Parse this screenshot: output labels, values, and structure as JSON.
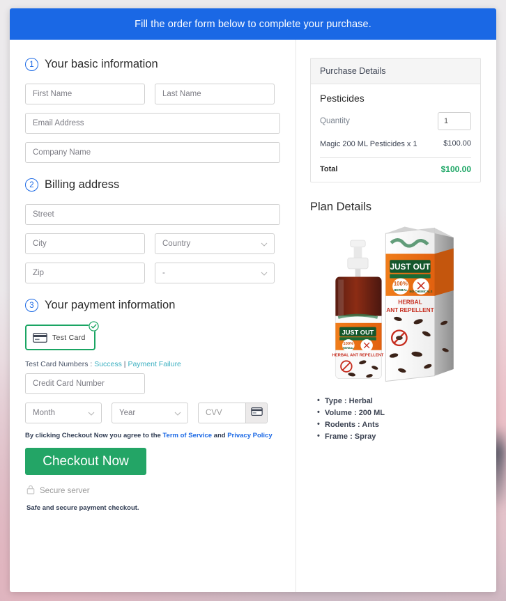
{
  "banner": {
    "text": "Fill the order form below to complete your purchase."
  },
  "steps": {
    "basic": {
      "num": "1",
      "title": "Your basic information"
    },
    "billing": {
      "num": "2",
      "title": "Billing address"
    },
    "payment": {
      "num": "3",
      "title": "Your payment information"
    }
  },
  "fields": {
    "first_name": "First Name",
    "last_name": "Last Name",
    "email": "Email Address",
    "company": "Company Name",
    "street": "Street",
    "city": "City",
    "country": "Country",
    "zip": "Zip",
    "state": "-",
    "card_number": "Credit Card Number",
    "month": "Month",
    "year": "Year",
    "cvv": "CVV"
  },
  "payment": {
    "test_card_label": "Test  Card",
    "test_numbers_label": "Test Card Numbers : ",
    "success_link": "Success",
    "pipe": " | ",
    "failure_link": "Payment Failure"
  },
  "terms": {
    "prefix": "By clicking Checkout Now you agree to the ",
    "tos": "Term of Service",
    "and": " and ",
    "privacy": "Privacy Policy"
  },
  "checkout": {
    "label": "Checkout Now"
  },
  "footer": {
    "secure_server": "Secure server",
    "safe_note": "Safe and secure payment checkout."
  },
  "purchase": {
    "panel_title": "Purchase Details",
    "product": "Pesticides",
    "quantity_label": "Quantity",
    "quantity_value": "1",
    "line_item": "Magic 200 ML Pesticides x 1",
    "line_amount": "$100.00",
    "total_label": "Total",
    "total_amount": "$100.00"
  },
  "plan": {
    "title": "Plan Details",
    "product_brand": "JUST OUT",
    "product_tagline": "HERBAL ANT REPELLENT",
    "badge_herbal": "100% HERBAL",
    "badge_nochem": "NO CHEMICALS",
    "details": [
      "Type : Herbal",
      "Volume : 200 ML",
      "Rodents : Ants",
      "Frame : Spray"
    ]
  },
  "colors": {
    "banner_blue": "#1a68e5",
    "accent_blue": "#1a68e5",
    "success_green": "#1aa563",
    "checkout_green": "#23a566",
    "link_teal": "#3aafc0"
  }
}
